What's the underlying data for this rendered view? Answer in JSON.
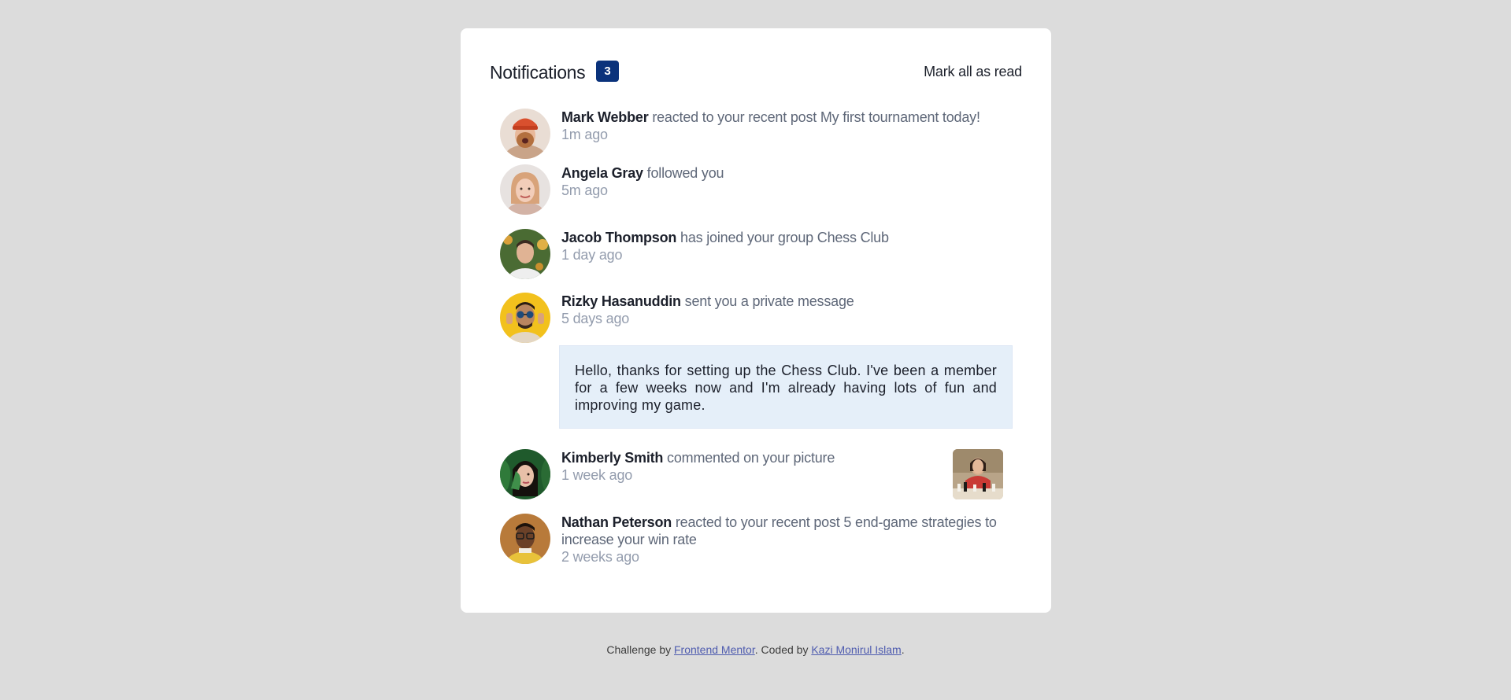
{
  "header": {
    "title": "Notifications",
    "unread_count": "3",
    "mark_all_label": "Mark all as read"
  },
  "notifications": [
    {
      "name": "Mark Webber",
      "action": "reacted to your recent post",
      "target": "My first tournament today!",
      "time": "1m ago"
    },
    {
      "name": "Angela Gray",
      "action": "followed you",
      "target": "",
      "time": "5m ago"
    },
    {
      "name": "Jacob Thompson",
      "action": "has joined your group",
      "target": "Chess Club",
      "time": "1 day ago"
    },
    {
      "name": "Rizky Hasanuddin",
      "action": "sent you a private message",
      "target": "",
      "time": "5 days ago",
      "message": "Hello, thanks for setting up the Chess Club. I've been a member for a few weeks now and I'm already having lots of fun and improving my game."
    },
    {
      "name": "Kimberly Smith",
      "action": "commented on your picture",
      "target": "",
      "time": "1 week ago"
    },
    {
      "name": "Nathan Peterson",
      "action": "reacted to your recent post",
      "target": "5 end-game strategies to increase your win rate",
      "time": "2 weeks ago"
    }
  ],
  "footer": {
    "prefix": "Challenge by",
    "link1": "Frontend Mentor",
    "middle": ". Coded by",
    "link2": "Kazi Monirul Islam",
    "suffix": "."
  },
  "colors": {
    "background": "#dcdcdc",
    "card": "#ffffff",
    "badge": "#0a327b",
    "name": "#1c202b",
    "body_text": "#5e6778",
    "time": "#939cad",
    "message_bg": "#e5eff9",
    "link": "#4f5caf"
  }
}
